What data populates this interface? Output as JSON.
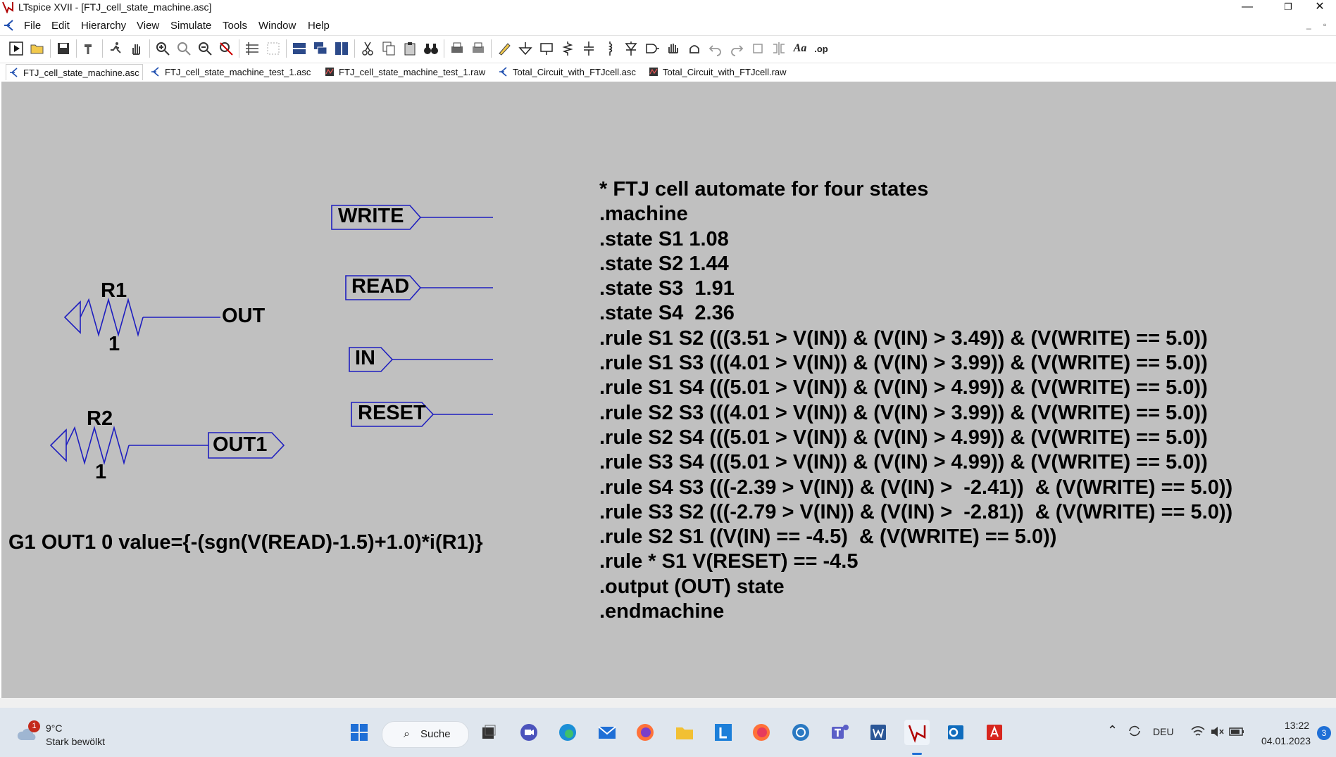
{
  "window": {
    "title": "LTspice XVII - [FTJ_cell_state_machine.asc]",
    "controls": [
      "—",
      "❐",
      "✕"
    ]
  },
  "menu": {
    "items": [
      "File",
      "Edit",
      "Hierarchy",
      "View",
      "Simulate",
      "Tools",
      "Window",
      "Help"
    ],
    "mdi_controls": [
      "_",
      "▫"
    ]
  },
  "tabs": [
    {
      "label": "FTJ_cell_state_machine.asc",
      "icon": "schematic-icon",
      "active": true
    },
    {
      "label": "FTJ_cell_state_machine_test_1.asc",
      "icon": "schematic-icon",
      "active": false
    },
    {
      "label": "FTJ_cell_state_machine_test_1.raw",
      "icon": "waveform-icon",
      "active": false
    },
    {
      "label": "Total_Circuit_with_FTJcell.asc",
      "icon": "schematic-icon",
      "active": false
    },
    {
      "label": "Total_Circuit_with_FTJcell.raw",
      "icon": "waveform-icon",
      "active": false
    }
  ],
  "toolbar": {
    "aa_label": "Aa",
    "op_label": ".op"
  },
  "schematic": {
    "net_labels": {
      "write": "WRITE",
      "read": "READ",
      "in": "IN",
      "reset": "RESET",
      "out1": "OUT1",
      "out": "OUT"
    },
    "components": {
      "r1_name": "R1",
      "r1_value": "1",
      "r2_name": "R2",
      "r2_value": "1"
    },
    "g1_directive": "G1 OUT1 0 value={-(sgn(V(READ)-1.5)+1.0)*i(R1)}",
    "spice_lines": [
      "* FTJ cell automate for four states",
      ".machine",
      ".state S1 1.08",
      ".state S2 1.44",
      ".state S3  1.91",
      ".state S4  2.36",
      ".rule S1 S2 (((3.51 > V(IN)) & (V(IN) > 3.49)) & (V(WRITE) == 5.0))",
      ".rule S1 S3 (((4.01 > V(IN)) & (V(IN) > 3.99)) & (V(WRITE) == 5.0))",
      ".rule S1 S4 (((5.01 > V(IN)) & (V(IN) > 4.99)) & (V(WRITE) == 5.0))",
      ".rule S2 S3 (((4.01 > V(IN)) & (V(IN) > 3.99)) & (V(WRITE) == 5.0))",
      ".rule S2 S4 (((5.01 > V(IN)) & (V(IN) > 4.99)) & (V(WRITE) == 5.0))",
      ".rule S3 S4 (((5.01 > V(IN)) & (V(IN) > 4.99)) & (V(WRITE) == 5.0))",
      ".rule S4 S3 (((-2.39 > V(IN)) & (V(IN) >  -2.41))  & (V(WRITE) == 5.0))",
      ".rule S3 S2 (((-2.79 > V(IN)) & (V(IN) >  -2.81))  & (V(WRITE) == 5.0))",
      ".rule S2 S1 ((V(IN) == -4.5)  & (V(WRITE) == 5.0))",
      ".rule * S1 V(RESET) == -4.5",
      ".output (OUT) state",
      ".endmachine"
    ]
  },
  "taskbar": {
    "weather_temp": "9°C",
    "weather_desc": "Stark bewölkt",
    "weather_badge": "1",
    "search_label": "Suche",
    "language": "DEU",
    "time": "13:22",
    "date": "04.01.2023",
    "notification_count": "3",
    "pinned": [
      "start-icon",
      "search-icon",
      "task-view-icon",
      "meet-icon",
      "edge-icon",
      "mail-icon",
      "firefox-icon",
      "explorer-icon",
      "l-app-icon",
      "firefox-icon",
      "vpn-icon",
      "teams-icon",
      "word-icon",
      "ltspice-icon",
      "outlook-icon",
      "acrobat-icon"
    ]
  },
  "colors": {
    "canvas": "#c0c0c0",
    "wire": "#1f1fbf",
    "text": "#000000"
  }
}
